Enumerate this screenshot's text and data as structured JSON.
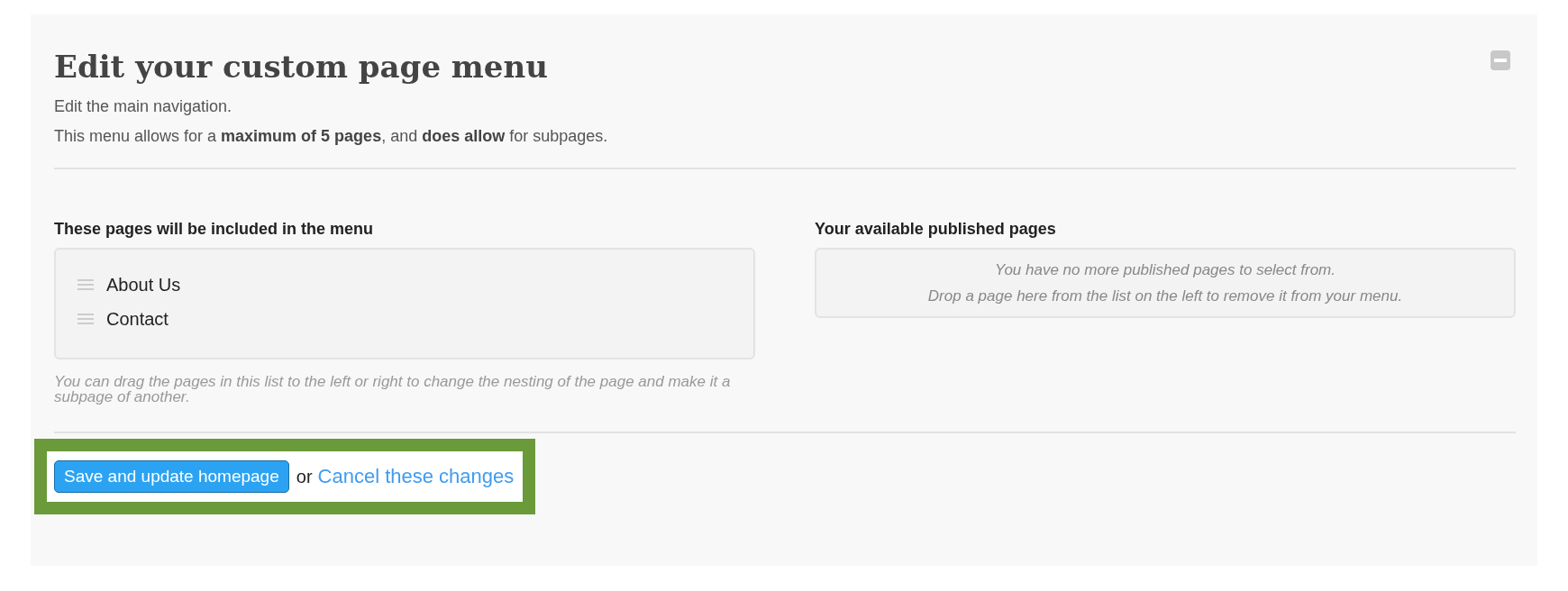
{
  "title": "Edit your custom page menu",
  "intro": [
    "Edit the main navigation.",
    "This menu allows for a **maximum of 5 pages**, and **does allow** for subpages."
  ],
  "included": {
    "heading": "These pages will be included in the menu",
    "items": [
      {
        "label": "About Us"
      },
      {
        "label": "Contact"
      }
    ],
    "help": "You can drag the pages in this list to the left or right to change the nesting of the page and make it a subpage of another."
  },
  "available": {
    "heading": "Your available published pages",
    "messages": [
      "You have no more published pages to select from.",
      "Drop a page here from the list on the left to remove it from your menu."
    ]
  },
  "actions": {
    "save": "Save and update homepage",
    "separator": "or",
    "cancel": "Cancel these changes"
  }
}
